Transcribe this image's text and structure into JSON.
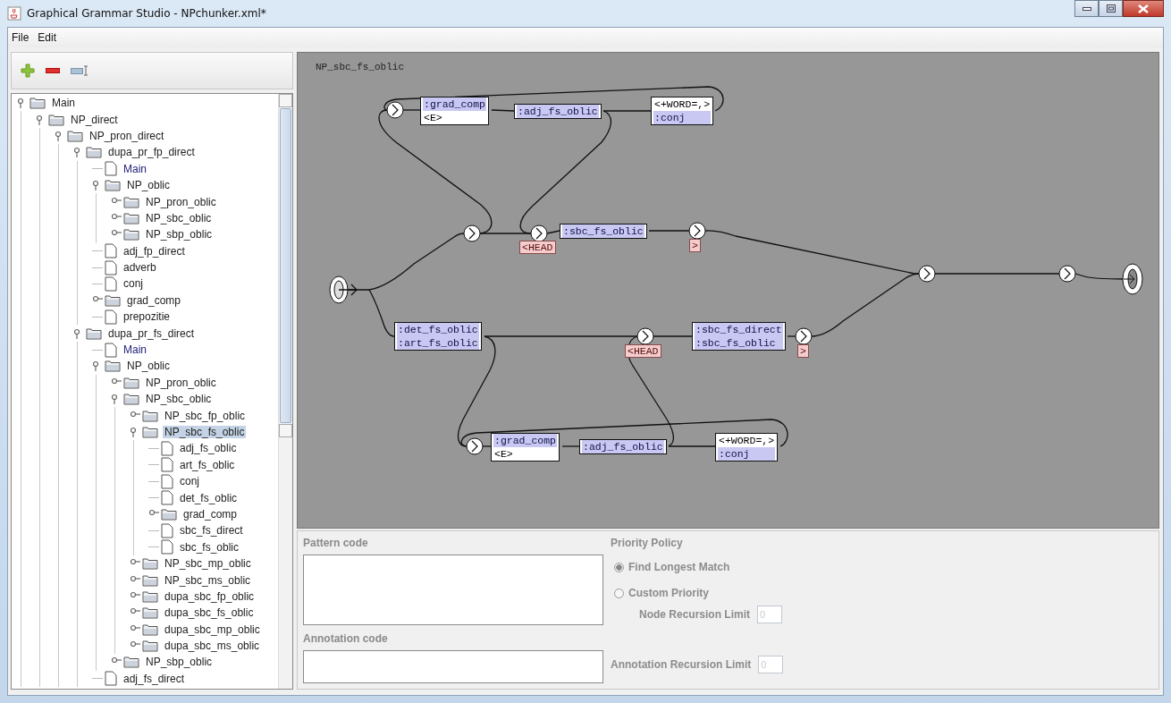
{
  "window": {
    "title": "Graphical Grammar Studio - NPchunker.xml*"
  },
  "menu": [
    "File",
    "Edit"
  ],
  "tree": [
    {
      "label": "Main",
      "kind": "folder",
      "expanded": true,
      "selected": false,
      "children": [
        {
          "label": "NP_direct",
          "kind": "folder",
          "expanded": true,
          "selected": false,
          "children": [
            {
              "label": "NP_pron_direct",
              "kind": "folder",
              "expanded": true,
              "selected": false,
              "children": [
                {
                  "label": "dupa_pr_fp_direct",
                  "kind": "folder",
                  "expanded": true,
                  "selected": false,
                  "children": [
                    {
                      "label": "Main",
                      "kind": "reference",
                      "selected": false
                    },
                    {
                      "label": "NP_oblic",
                      "kind": "folder",
                      "expanded": true,
                      "selected": false,
                      "children": [
                        {
                          "label": "NP_pron_oblic",
                          "kind": "folder",
                          "expanded": false,
                          "selected": false
                        },
                        {
                          "label": "NP_sbc_oblic",
                          "kind": "folder",
                          "expanded": false,
                          "selected": false
                        },
                        {
                          "label": "NP_sbp_oblic",
                          "kind": "folder",
                          "expanded": false,
                          "selected": false
                        }
                      ]
                    },
                    {
                      "label": "adj_fp_direct",
                      "kind": "file",
                      "selected": false
                    },
                    {
                      "label": "adverb",
                      "kind": "file",
                      "selected": false
                    },
                    {
                      "label": "conj",
                      "kind": "file",
                      "selected": false
                    },
                    {
                      "label": "grad_comp",
                      "kind": "folder",
                      "expanded": false,
                      "selected": false
                    },
                    {
                      "label": "prepozitie",
                      "kind": "file",
                      "selected": false
                    }
                  ]
                },
                {
                  "label": "dupa_pr_fs_direct",
                  "kind": "folder",
                  "expanded": true,
                  "selected": false,
                  "children": [
                    {
                      "label": "Main",
                      "kind": "reference",
                      "selected": false
                    },
                    {
                      "label": "NP_oblic",
                      "kind": "folder",
                      "expanded": true,
                      "selected": false,
                      "children": [
                        {
                          "label": "NP_pron_oblic",
                          "kind": "folder",
                          "expanded": false,
                          "selected": false
                        },
                        {
                          "label": "NP_sbc_oblic",
                          "kind": "folder",
                          "expanded": true,
                          "selected": false,
                          "children": [
                            {
                              "label": "NP_sbc_fp_oblic",
                              "kind": "folder",
                              "expanded": false,
                              "selected": false
                            },
                            {
                              "label": "NP_sbc_fs_oblic",
                              "kind": "folder",
                              "expanded": true,
                              "selected": true,
                              "children": [
                                {
                                  "label": "adj_fs_oblic",
                                  "kind": "file",
                                  "selected": false
                                },
                                {
                                  "label": "art_fs_oblic",
                                  "kind": "file",
                                  "selected": false
                                },
                                {
                                  "label": "conj",
                                  "kind": "file",
                                  "selected": false
                                },
                                {
                                  "label": "det_fs_oblic",
                                  "kind": "file",
                                  "selected": false
                                },
                                {
                                  "label": "grad_comp",
                                  "kind": "folder",
                                  "expanded": false,
                                  "selected": false
                                },
                                {
                                  "label": "sbc_fs_direct",
                                  "kind": "file",
                                  "selected": false
                                },
                                {
                                  "label": "sbc_fs_oblic",
                                  "kind": "file",
                                  "selected": false
                                }
                              ]
                            },
                            {
                              "label": "NP_sbc_mp_oblic",
                              "kind": "folder",
                              "expanded": false,
                              "selected": false
                            },
                            {
                              "label": "NP_sbc_ms_oblic",
                              "kind": "folder",
                              "expanded": false,
                              "selected": false
                            },
                            {
                              "label": "dupa_sbc_fp_oblic",
                              "kind": "folder",
                              "expanded": false,
                              "selected": false
                            },
                            {
                              "label": "dupa_sbc_fs_oblic",
                              "kind": "folder",
                              "expanded": false,
                              "selected": false
                            },
                            {
                              "label": "dupa_sbc_mp_oblic",
                              "kind": "folder",
                              "expanded": false,
                              "selected": false
                            },
                            {
                              "label": "dupa_sbc_ms_oblic",
                              "kind": "folder",
                              "expanded": false,
                              "selected": false
                            }
                          ]
                        },
                        {
                          "label": "NP_sbp_oblic",
                          "kind": "folder",
                          "expanded": false,
                          "selected": false
                        }
                      ]
                    },
                    {
                      "label": "adj_fs_direct",
                      "kind": "file",
                      "selected": false
                    }
                  ]
                }
              ]
            }
          ]
        }
      ]
    }
  ],
  "graph": {
    "title": "NP_sbc_fs_oblic",
    "boxes": [
      {
        "lines": [
          {
            "text": ":grad_comp",
            "kind": "call"
          },
          {
            "text": "<E>",
            "kind": "token"
          }
        ]
      },
      {
        "lines": [
          {
            "text": ":adj_fs_oblic",
            "kind": "call"
          }
        ]
      },
      {
        "lines": [
          {
            "text": "<+WORD=,>",
            "kind": "token"
          },
          {
            "text": ":conj",
            "kind": "call"
          }
        ]
      },
      {
        "lines": [
          {
            "text": ":sbc_fs_oblic",
            "kind": "call"
          }
        ]
      },
      {
        "lines": [
          {
            "text": ":det_fs_oblic",
            "kind": "call"
          },
          {
            "text": ":art_fs_oblic",
            "kind": "call"
          }
        ]
      },
      {
        "lines": [
          {
            "text": ":sbc_fs_direct",
            "kind": "call"
          },
          {
            "text": ":sbc_fs_oblic",
            "kind": "call"
          }
        ]
      },
      {
        "lines": [
          {
            "text": ":grad_comp",
            "kind": "call"
          },
          {
            "text": "<E>",
            "kind": "token"
          }
        ]
      },
      {
        "lines": [
          {
            "text": ":adj_fs_oblic",
            "kind": "call"
          }
        ]
      },
      {
        "lines": [
          {
            "text": "<+WORD=,>",
            "kind": "token"
          },
          {
            "text": ":conj",
            "kind": "call"
          }
        ]
      }
    ],
    "outputs": [
      "<HEAD",
      ">",
      "<HEAD",
      ">"
    ]
  },
  "pattern_code": {
    "label": "Pattern code"
  },
  "annotation_code": {
    "label": "Annotation code"
  },
  "priority_policy": {
    "label": "Priority Policy",
    "disabled": true,
    "options": [
      {
        "label": "Find Longest Match",
        "selected": true
      },
      {
        "label": "Custom Priority",
        "selected": false
      }
    ]
  },
  "node_recursion_limit": {
    "label": "Node Recursion Limit",
    "value": "0",
    "disabled": true
  },
  "annotation_recursion_limit": {
    "label": "Annotation Recursion Limit",
    "value": "0",
    "disabled": true
  }
}
